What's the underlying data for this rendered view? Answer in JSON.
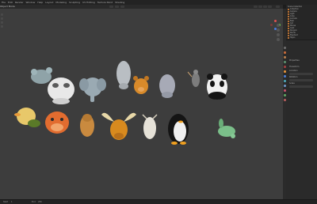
{
  "topbar": {
    "menu": [
      "File",
      "Edit",
      "Render",
      "Window",
      "Help",
      "Layout",
      "Modeling",
      "Sculpting",
      "UV Editing",
      "Texture Paint",
      "Shading"
    ],
    "mode": "Object Mode"
  },
  "outliner": {
    "title": "Scene Collection",
    "items": [
      "Collection",
      "Camera",
      "Light",
      "Cube",
      "Animals",
      "Bear",
      "Cat",
      "Moose",
      "Goat",
      "Penguin",
      "Panda",
      "Elephant",
      "Hippo"
    ]
  },
  "properties": {
    "title": "Properties",
    "labels": [
      "Transform",
      "Location",
      "Rotation",
      "Scale"
    ]
  },
  "timeline": {
    "start_label": "Start",
    "start": "1",
    "end_label": "End",
    "end": "250"
  },
  "colors": {
    "viewport_bg": "#3d3d3d",
    "accent": "#e78a3a"
  }
}
